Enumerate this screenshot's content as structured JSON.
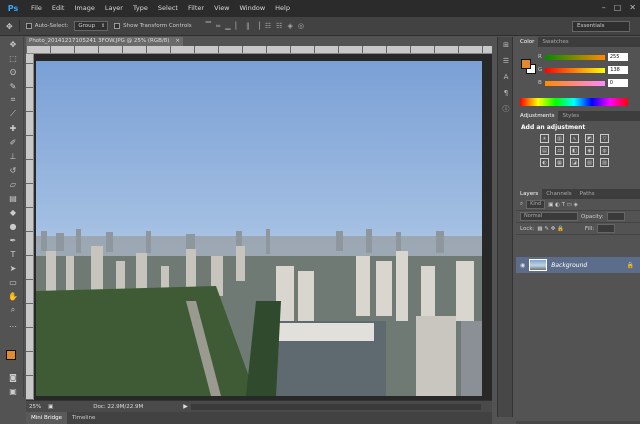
{
  "menubar": {
    "logo": "Ps",
    "items": [
      "File",
      "Edit",
      "Image",
      "Layer",
      "Type",
      "Select",
      "Filter",
      "View",
      "Window",
      "Help"
    ]
  },
  "options": {
    "auto_select_label": "Auto-Select:",
    "group_value": "Group",
    "transform_label": "Show Transform Controls",
    "workspace": "Essentials"
  },
  "document": {
    "tab_title": "Photo_20141217105241 3FOW.JPG @ 25% (RGB/8)",
    "zoom": "25%",
    "doc_info": "Doc: 22.9M/22.9M"
  },
  "bottom_tabs": [
    "Mini Bridge",
    "Timeline"
  ],
  "color_panel": {
    "tabs": [
      "Color",
      "Swatches"
    ],
    "r": "255",
    "g": "138",
    "b": "0",
    "r_label": "R",
    "g_label": "G",
    "b_label": "B",
    "fg_color": "#e18a2e"
  },
  "adjustments": {
    "tabs": [
      "Adjustments",
      "Styles"
    ],
    "title": "Add an adjustment"
  },
  "layers": {
    "tabs": [
      "Layers",
      "Channels",
      "Paths"
    ],
    "kind_label": "Kind",
    "blend_mode": "Normal",
    "opacity_label": "Opacity:",
    "lock_label": "Lock:",
    "fill_label": "Fill:",
    "layer_name": "Background"
  }
}
